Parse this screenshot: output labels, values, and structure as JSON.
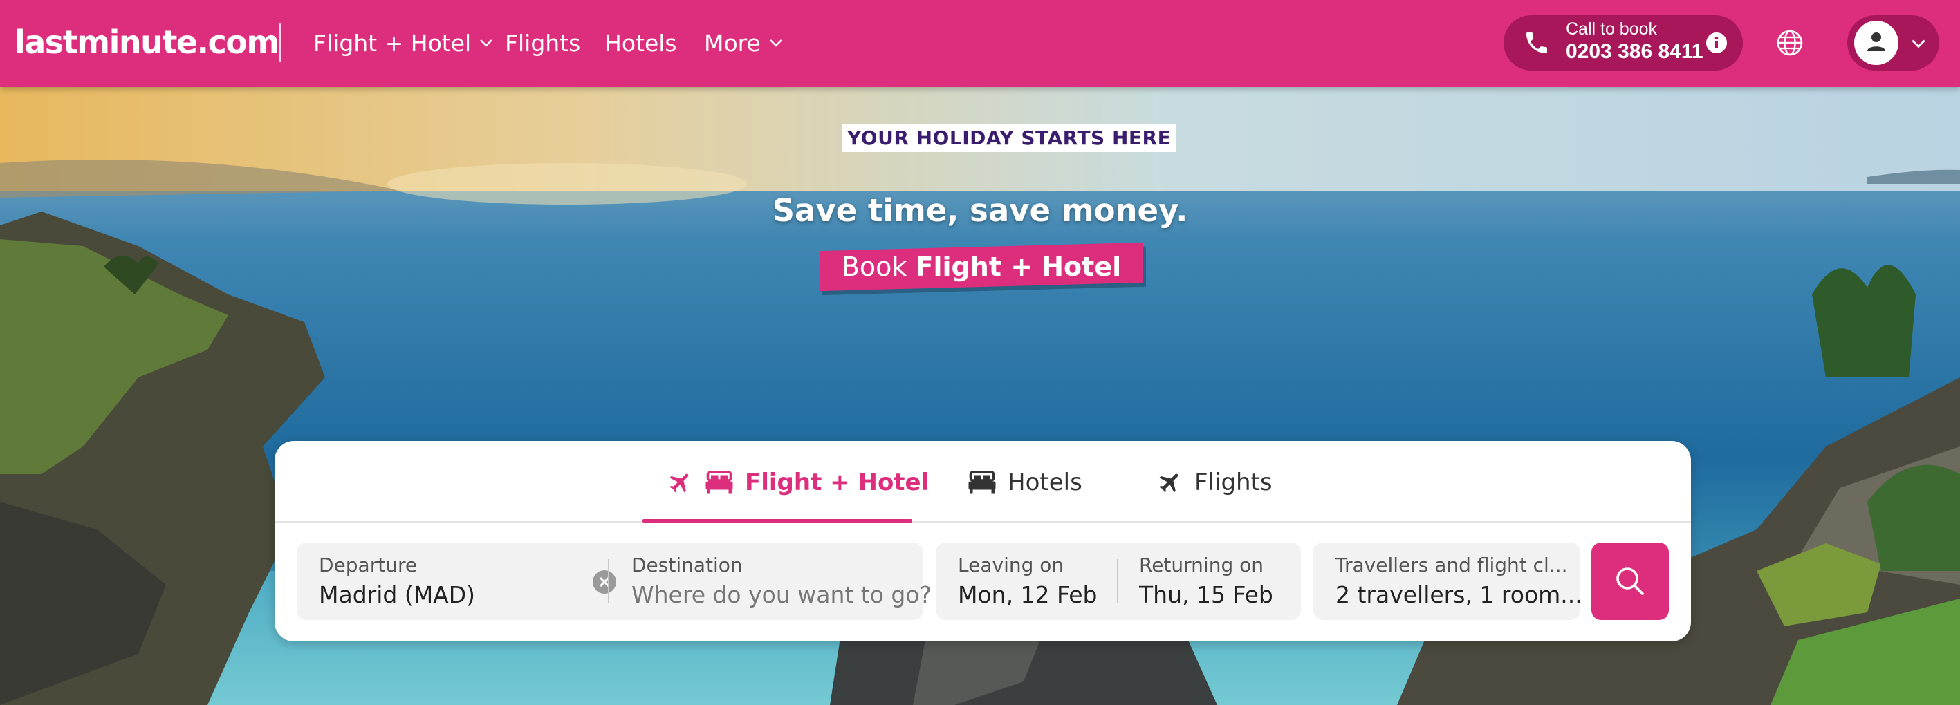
{
  "header": {
    "logo": "lastminute.com",
    "nav": [
      {
        "label": "Flight + Hotel",
        "has_dropdown": true
      },
      {
        "label": "Flights",
        "has_dropdown": false
      },
      {
        "label": "Hotels",
        "has_dropdown": false
      },
      {
        "label": "More",
        "has_dropdown": true
      }
    ],
    "call": {
      "label": "Call to book",
      "number": "0203 386 8411",
      "icons": [
        "phone-icon",
        "info-icon"
      ]
    },
    "language_icon": "globe-icon",
    "account_icon": "user-icon"
  },
  "hero": {
    "tagline": "YOUR HOLIDAY STARTS HERE",
    "headline": "Save time, save money.",
    "banner_prefix": "Book",
    "banner_bold": "Flight + Hotel"
  },
  "search": {
    "tabs": [
      {
        "label": "Flight + Hotel",
        "active": true,
        "icons": [
          "plane-icon",
          "bed-icon"
        ]
      },
      {
        "label": "Hotels",
        "active": false,
        "icons": [
          "bed-icon"
        ]
      },
      {
        "label": "Flights",
        "active": false,
        "icons": [
          "plane-icon"
        ]
      }
    ],
    "departure": {
      "label": "Departure",
      "value": "Madrid (MAD)"
    },
    "destination": {
      "label": "Destination",
      "placeholder": "Where do you want to go?"
    },
    "leaving": {
      "label": "Leaving on",
      "value": "Mon, 12 Feb"
    },
    "returning": {
      "label": "Returning on",
      "value": "Thu, 15 Feb"
    },
    "travellers": {
      "label": "Travellers and flight cl...",
      "value": "2 travellers, 1 room..."
    },
    "search_icon": "search-icon"
  },
  "colors": {
    "brand": "#dd2e7e",
    "brand_dark": "#a8175a",
    "tagline_text": "#3a1d6e",
    "field_bg": "#f2f2f2"
  }
}
